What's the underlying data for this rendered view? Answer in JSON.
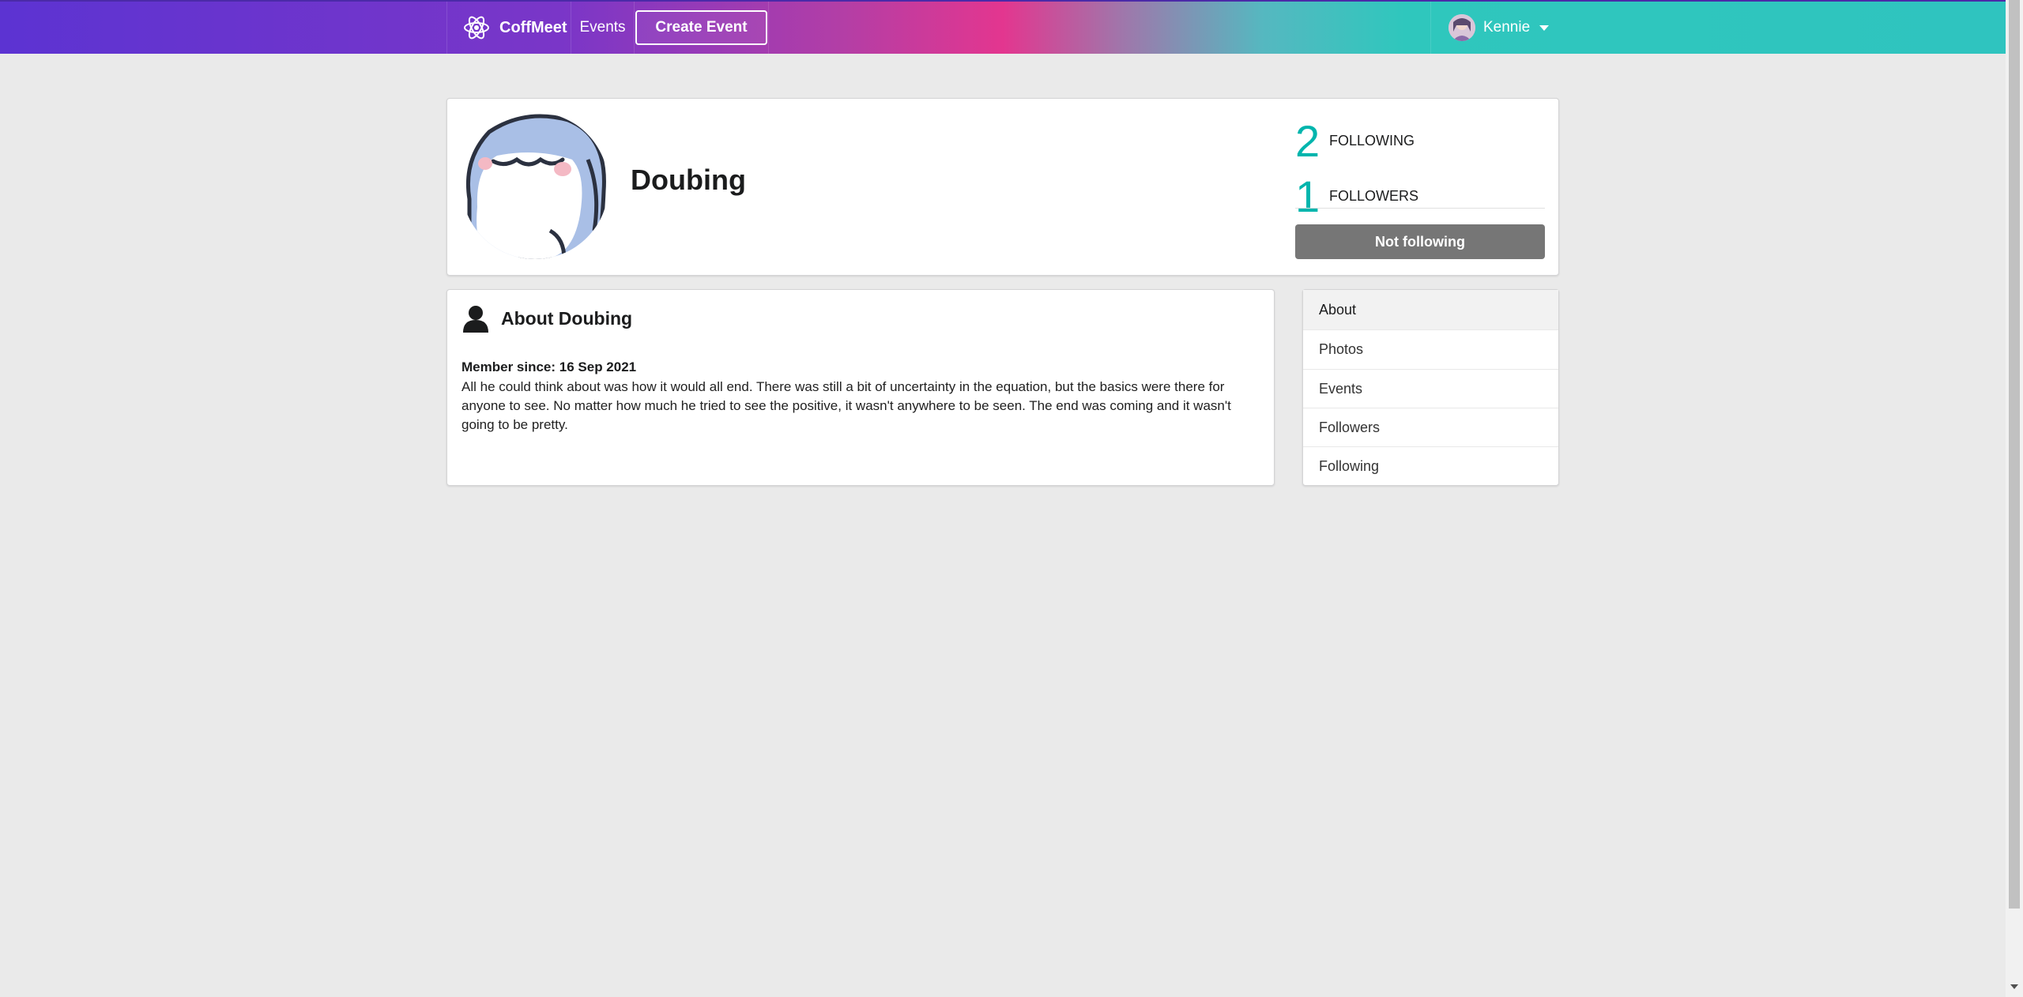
{
  "nav": {
    "brand": "CoffMeet",
    "events_label": "Events",
    "create_label": "Create Event",
    "user_name": "Kennie"
  },
  "profile": {
    "name": "Doubing",
    "following_count": "2",
    "following_label": "FOLLOWING",
    "followers_count": "1",
    "followers_label": "FOLLOWERS",
    "follow_button": "Not following"
  },
  "about": {
    "title": "About Doubing",
    "member_since": "Member since: 16 Sep 2021",
    "bio": "All he could think about was how it would all end. There was still a bit of uncertainty in the equation, but the basics were there for anyone to see. No matter how much he tried to see the positive, it wasn't anywhere to be seen. The end was coming and it wasn't going to be pretty."
  },
  "menu": {
    "items": [
      {
        "label": "About"
      },
      {
        "label": "Photos"
      },
      {
        "label": "Events"
      },
      {
        "label": "Followers"
      },
      {
        "label": "Following"
      }
    ]
  },
  "colors": {
    "accent_teal": "#00b5ad",
    "nav_gradient_start": "#5c33d2",
    "nav_gradient_mid": "#e3368f",
    "nav_gradient_end": "#2fc4bf",
    "button_grey": "#767676"
  }
}
